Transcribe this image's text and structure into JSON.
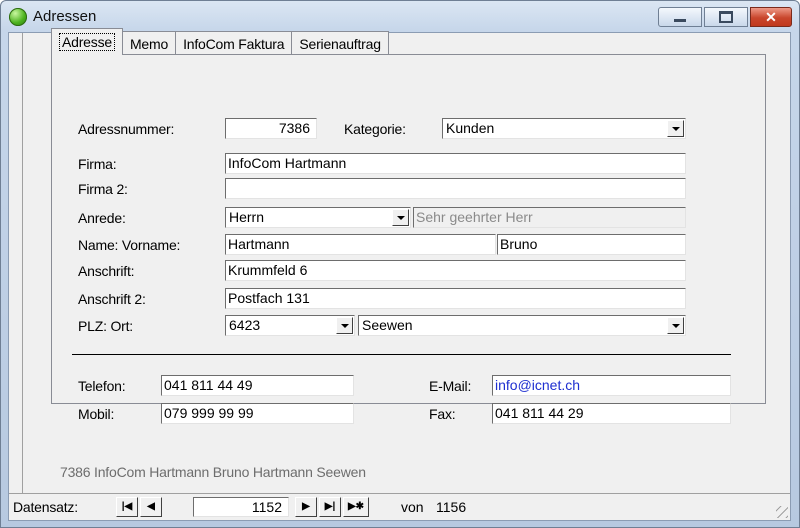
{
  "window": {
    "title": "Adressen"
  },
  "tabs": [
    "Adresse",
    "Memo",
    "InfoCom Faktura",
    "Serienauftrag"
  ],
  "form": {
    "adressnummer_label": "Adressnummer:",
    "adressnummer": "7386",
    "kategorie_label": "Kategorie:",
    "kategorie": "Kunden",
    "firma_label": "Firma:",
    "firma": "InfoCom Hartmann",
    "firma2_label": "Firma 2:",
    "firma2": "",
    "anrede_label": "Anrede:",
    "anrede": "Herrn",
    "briefanrede": "Sehr geehrter Herr",
    "name_label": "Name: Vorname:",
    "name": "Hartmann",
    "vorname": "Bruno",
    "anschrift_label": "Anschrift:",
    "anschrift": "Krummfeld 6",
    "anschrift2_label": "Anschrift 2:",
    "anschrift2": "Postfach 131",
    "plz_ort_label": "PLZ: Ort:",
    "plz": "6423",
    "ort": "Seewen",
    "telefon_label": "Telefon:",
    "telefon": "041 811 44 49",
    "mobil_label": "Mobil:",
    "mobil": "079 999 99 99",
    "email_label": "E-Mail:",
    "email": "info@icnet.ch",
    "fax_label": "Fax:",
    "fax": "041 811 44 29"
  },
  "summary": "7386 InfoCom Hartmann Bruno Hartmann Seewen",
  "navigation": {
    "label": "Datensatz:",
    "first": "|◀",
    "prev": "◀",
    "current": "1152",
    "next": "▶",
    "last": "▶|",
    "new": "▶✱",
    "of_label": "von",
    "total": "1156"
  },
  "colors": {
    "close_button": "#c9462c",
    "email_text": "#1e2fd0",
    "summary_text": "#6d6d6d"
  }
}
